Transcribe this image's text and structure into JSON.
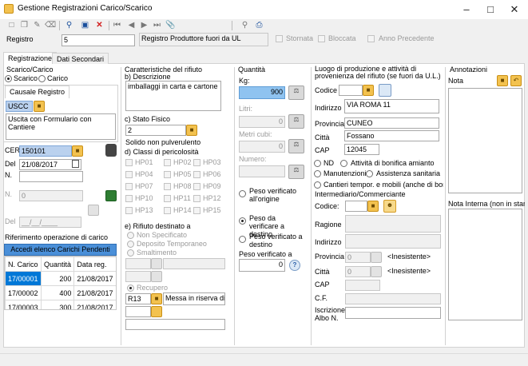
{
  "window": {
    "title": "Gestione Registrazioni Carico/Scarico"
  },
  "header": {
    "registro_label": "Registro",
    "registro_value": "5",
    "registro_desc": "Registro Produttore fuori da UL",
    "stornata": "Stornata",
    "bloccata": "Bloccata",
    "anno_precedente": "Anno Precedente"
  },
  "tabs": [
    "Registrazione",
    "Dati Secondari"
  ],
  "scarico_carico": {
    "title": "Scarico/Carico",
    "scarico": "Scarico",
    "carico": "Carico",
    "causale_tab": "Causale Registro",
    "causale_code": "USCC",
    "causale_desc": "Uscita con Formulario con Cantiere"
  },
  "cer": {
    "cer_label": "CER",
    "cer_value": "150101",
    "del_label": "Del",
    "del_value": "21/08/2017",
    "n_label": "N.",
    "n2_label": "N.",
    "n2_value": "0",
    "del2_label": "Del",
    "del2_value": "__/__/____"
  },
  "riferimento": {
    "title": "Riferimento operazione di carico",
    "button": "Accedi elenco Carichi Pendenti",
    "headers": [
      "N. Carico",
      "Quantità",
      "Data reg."
    ],
    "rows": [
      [
        "17/00001",
        "200",
        "21/08/2017"
      ],
      [
        "17/00002",
        "400",
        "21/08/2017"
      ],
      [
        "17/00003",
        "300",
        "21/08/2017"
      ]
    ]
  },
  "caratteristiche": {
    "title": "Caratteristiche del rifiuto",
    "descr_label": "b) Descrizione",
    "descr_value": "imballaggi in carta e cartone",
    "stato_label": "c) Stato Fisico",
    "stato_value": "2",
    "stato_desc": "Solido non pulverulento",
    "classi_label": "d) Classi di pericolosità",
    "classi": [
      "HP01",
      "HP02",
      "HP03",
      "HP04",
      "HP05",
      "HP06",
      "HP07",
      "HP08",
      "HP09",
      "HP10",
      "HP11",
      "HP12",
      "HP13",
      "HP14",
      "HP15"
    ],
    "destinato_label": "e) Rifiuto destinato a",
    "non_specificato": "Non Specificato",
    "deposito": "Deposito Temporaneo",
    "smaltimento": "Smaltimento",
    "recupero": "Recupero",
    "r_code": "R13",
    "r_desc": "Messa in riserva di"
  },
  "quantita": {
    "title": "Quantità",
    "kg_label": "Kg:",
    "kg_value": "900",
    "litri_label": "Litri:",
    "litri_value": "0",
    "metri_label": "Metri cubi:",
    "metri_value": "0",
    "numero_label": "Numero:",
    "peso_origine": "Peso verificato all'origine",
    "peso_verificare": "Peso da verificare a destino",
    "peso_verificato_dest": "Peso verificato a destino",
    "peso_verificato_label": "Peso verificato a",
    "peso_verificato_value": "0"
  },
  "luogo": {
    "title": "Luogo di produzione e attività di provenienza del rifiuto (se fuori da U.L.)",
    "codice_label": "Codice",
    "indirizzo_label": "Indirizzo",
    "indirizzo_value": "VIA ROMA 11",
    "provincia_label": "Provincia",
    "provincia_value": "CUNEO",
    "citta_label": "Città",
    "citta_value": "Fossano",
    "cap_label": "CAP",
    "cap_value": "12045",
    "nd": "ND",
    "bonifica": "Attività di bonifica amianto",
    "manutenzioni": "Manutenzioni",
    "assistenza": "Assistenza sanitaria",
    "cantieri": "Cantieri tempor. e mobili (anche di bonifica)"
  },
  "intermediario": {
    "title": "Intermediario/Commerciante",
    "codice_label": "Codice:",
    "ragione_label": "Ragione",
    "indirizzo_label": "Indirizzo",
    "provincia_label": "Provincia",
    "provincia_value": "0",
    "provincia_desc": "<Inesistente>",
    "citta_label": "Città",
    "citta_value": "0",
    "citta_desc": "<Inesistente>",
    "cap_label": "CAP",
    "cf_label": "C.F.",
    "iscrizione_label": "Iscrizione Albo N."
  },
  "annotazioni": {
    "title": "Annotazioni",
    "nota_label": "Nota",
    "nota_interna_label": "Nota Interna (non in stampa"
  }
}
